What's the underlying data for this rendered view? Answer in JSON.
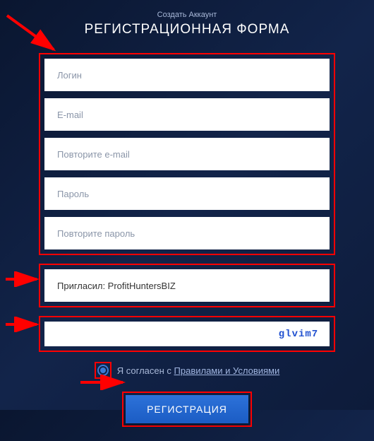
{
  "header": {
    "subtitle": "Создать Аккаунт",
    "title": "РЕГИСТРАЦИОННАЯ ФОРМА"
  },
  "form": {
    "login_placeholder": "Логин",
    "email_placeholder": "E-mail",
    "email_repeat_placeholder": "Повторите e-mail",
    "password_placeholder": "Пароль",
    "password_repeat_placeholder": "Повторите пароль"
  },
  "referral": {
    "value": "Пригласил: ProfitHuntersBIZ"
  },
  "captcha": {
    "code": "glvim7"
  },
  "agreement": {
    "prefix": "Я согласен с ",
    "link": "Правилами и Условиями"
  },
  "submit": {
    "label": "РЕГИСТРАЦИЯ"
  }
}
